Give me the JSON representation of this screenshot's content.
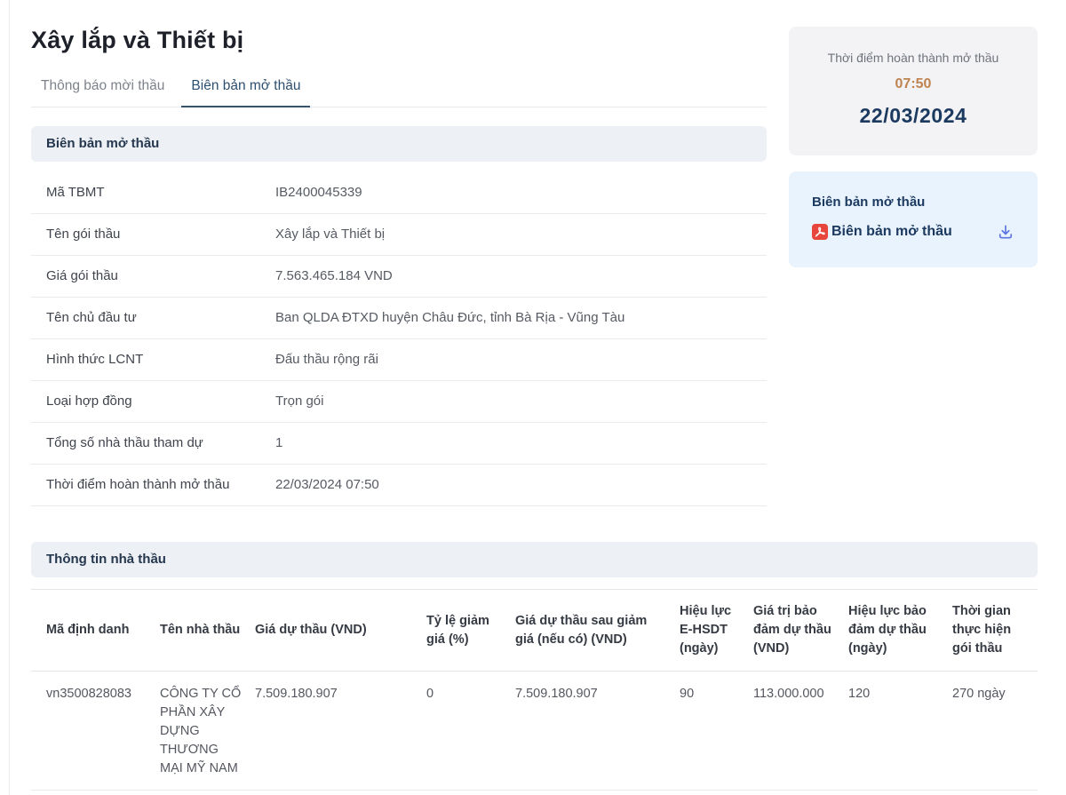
{
  "page": {
    "title": "Xây lắp và Thiết bị"
  },
  "tabs": [
    {
      "label": "Thông báo mời thầu",
      "active": false
    },
    {
      "label": "Biên bản mở thầu",
      "active": true
    }
  ],
  "bid_opening": {
    "section_title": "Biên bản mở thầu",
    "fields": [
      {
        "label": "Mã TBMT",
        "value": "IB2400045339"
      },
      {
        "label": "Tên gói thầu",
        "value": "Xây lắp và Thiết bị"
      },
      {
        "label": "Giá gói thầu",
        "value": "7.563.465.184 VND"
      },
      {
        "label": "Tên chủ đầu tư",
        "value": "Ban QLDA ĐTXD huyện Châu Đức, tỉnh Bà Rịa - Vũng Tàu"
      },
      {
        "label": "Hình thức LCNT",
        "value": "Đấu thầu rộng rãi"
      },
      {
        "label": "Loại hợp đồng",
        "value": "Trọn gói"
      },
      {
        "label": "Tổng số nhà thầu tham dự",
        "value": "1"
      },
      {
        "label": "Thời điểm hoàn thành mở thầu",
        "value": "22/03/2024 07:50"
      }
    ]
  },
  "sidebar": {
    "completion_card": {
      "label": "Thời điểm hoàn thành mở thầu",
      "time": "07:50",
      "date": "22/03/2024"
    },
    "download_card": {
      "title": "Biên bản mở thầu",
      "file_label": "Biên bản mở thầu",
      "pdf_icon": "pdf-file-icon",
      "download_icon": "download-icon"
    }
  },
  "contractors": {
    "section_title": "Thông tin nhà thầu",
    "table": {
      "columns": [
        "Mã định danh",
        "Tên nhà thầu",
        "Giá dự thầu (VND)",
        "Tỷ lệ giảm giá (%)",
        "Giá dự thầu sau giảm giá (nếu có) (VND)",
        "Hiệu lực E-HSDT (ngày)",
        "Giá trị bảo đảm dự thầu (VND)",
        "Hiệu lực bảo đảm dự thầu (ngày)",
        "Thời gian thực hiện gói thầu"
      ],
      "rows": [
        [
          "vn3500828083",
          "CÔNG TY CỔ PHẦN XÂY DỰNG THƯƠNG MẠI MỸ NAM",
          "7.509.180.907",
          "0",
          "7.509.180.907",
          "90",
          "113.000.000",
          "120",
          "270 ngày"
        ]
      ]
    }
  },
  "colors": {
    "navy_heading": "#1c3a60",
    "tab_active": "#2d4f70",
    "time_orange": "#bf8350",
    "pdf_red": "#e8453c",
    "download_blue": "#5b74e0",
    "card_gray": "#f3f3f5",
    "card_blue": "#e9f3fd",
    "section_bg": "#edf0f4"
  }
}
